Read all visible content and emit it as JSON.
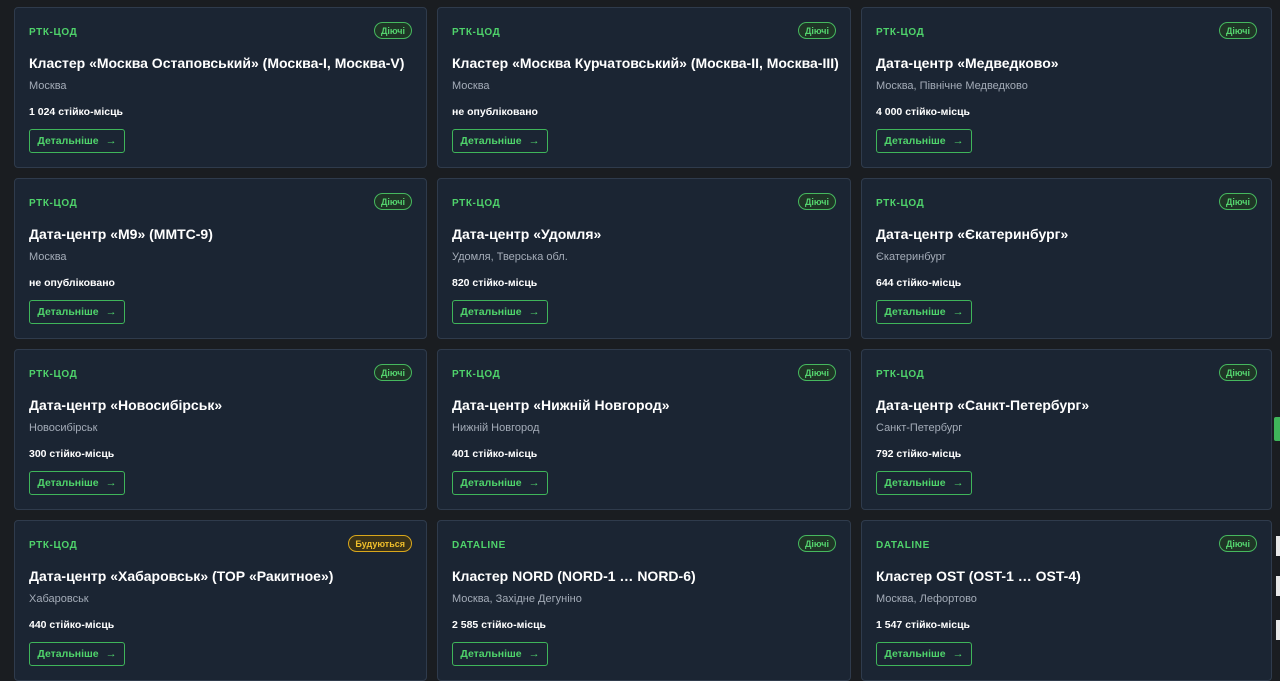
{
  "common": {
    "details_label": "Детальніше",
    "details_arrow": "→"
  },
  "colors": {
    "accent": "#4fd36b",
    "card_bg": "#1b2533",
    "page_bg": "#1a1d21",
    "status_active": "#54d36e",
    "status_building": "#f0bf2b"
  },
  "icons": {
    "arrow": "arrow-right-icon"
  },
  "cards": [
    {
      "operator": "РТК-ЦОД",
      "status": "Діючі",
      "title": "Кластер «Москва Остаповський» (Москва-I, Москва-V)",
      "location": "Москва",
      "capacity": "1 024 стійко-місць"
    },
    {
      "operator": "РТК-ЦОД",
      "status": "Діючі",
      "title": "Кластер «Москва Курчатовський» (Москва-II, Москва-III)",
      "location": "Москва",
      "capacity": "не опубліковано"
    },
    {
      "operator": "РТК-ЦОД",
      "status": "Діючі",
      "title": "Дата-центр «Медведково»",
      "location": "Москва, Північне Медведково",
      "capacity": "4 000 стійко-місць"
    },
    {
      "operator": "РТК-ЦОД",
      "status": "Діючі",
      "title": "Дата-центр «М9» (ММТС-9)",
      "location": "Москва",
      "capacity": "не опубліковано"
    },
    {
      "operator": "РТК-ЦОД",
      "status": "Діючі",
      "title": "Дата-центр «Удомля»",
      "location": "Удомля, Тверська обл.",
      "capacity": "820 стійко-місць"
    },
    {
      "operator": "РТК-ЦОД",
      "status": "Діючі",
      "title": "Дата-центр «Єкатеринбург»",
      "location": "Єкатеринбург",
      "capacity": "644 стійко-місць"
    },
    {
      "operator": "РТК-ЦОД",
      "status": "Діючі",
      "title": "Дата-центр «Новосибірськ»",
      "location": "Новосибірськ",
      "capacity": "300 стійко-місць"
    },
    {
      "operator": "РТК-ЦОД",
      "status": "Діючі",
      "title": "Дата-центр «Нижній Новгород»",
      "location": "Нижній Новгород",
      "capacity": "401 стійко-місць"
    },
    {
      "operator": "РТК-ЦОД",
      "status": "Діючі",
      "title": "Дата-центр «Санкт-Петербург»",
      "location": "Санкт-Петербург",
      "capacity": "792 стійко-місць"
    },
    {
      "operator": "РТК-ЦОД",
      "status": "Будуються",
      "title": "Дата-центр «Хабаровськ» (ТОР «Ракитное»)",
      "location": "Хабаровськ",
      "capacity": "440 стійко-місць"
    },
    {
      "operator": "DATALINE",
      "status": "Діючі",
      "title": "Кластер NORD (NORD-1 … NORD-6)",
      "location": "Москва, Західне Дегуніно",
      "capacity": "2 585 стійко-місць"
    },
    {
      "operator": "DATALINE",
      "status": "Діючі",
      "title": "Кластер OST (OST-1 … OST-4)",
      "location": "Москва, Лефортово",
      "capacity": "1 547 стійко-місць"
    }
  ]
}
